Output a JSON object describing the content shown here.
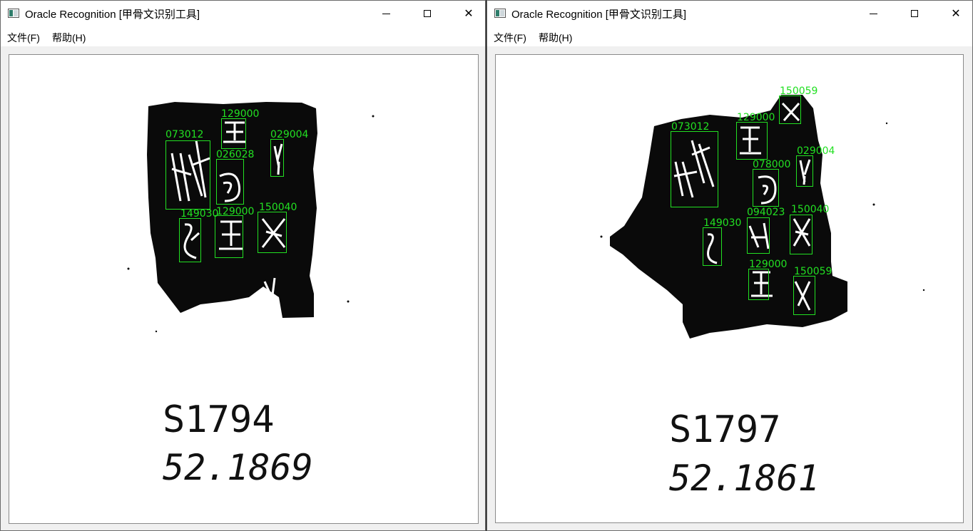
{
  "windows": [
    {
      "title": "Oracle Recognition [甲骨文识别工具]",
      "menu": {
        "file": "文件(F)",
        "help": "帮助(H)"
      },
      "catalog_id": "S1794",
      "accession_no": "52.1869",
      "detections": [
        "073012",
        "129000",
        "029004",
        "026028",
        "149030",
        "129000",
        "150040"
      ]
    },
    {
      "title": "Oracle Recognition [甲骨文识别工具]",
      "menu": {
        "file": "文件(F)",
        "help": "帮助(H)"
      },
      "catalog_id": "S1797",
      "accession_no": "52.1861",
      "detections": [
        "150059",
        "129000",
        "073012",
        "029004",
        "078000",
        "149030",
        "094023",
        "150040",
        "129000",
        "150059"
      ]
    }
  ],
  "colors": {
    "detection": "#22e022",
    "fragment": "#0a0a0a"
  },
  "icons": {
    "minimize": "minimize-icon",
    "maximize": "maximize-icon",
    "close": "close-icon",
    "app": "app-icon"
  }
}
